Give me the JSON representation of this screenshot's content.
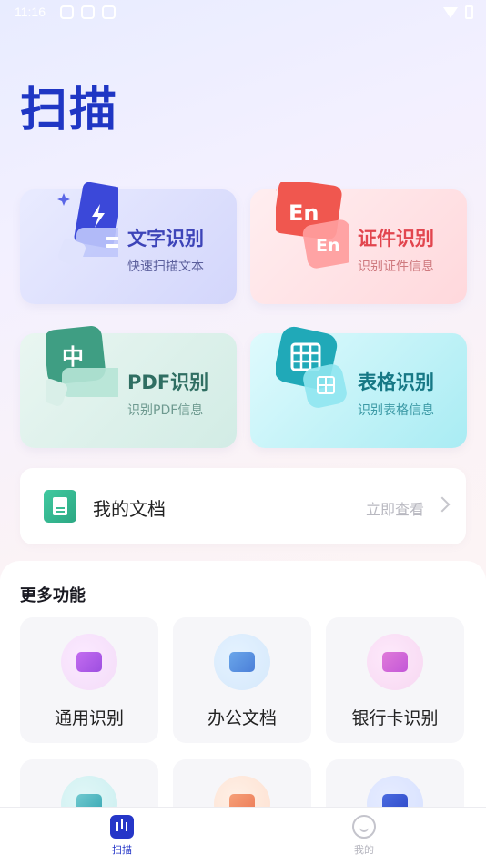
{
  "status_bar": {
    "time": "11:16"
  },
  "page": {
    "title": "扫描"
  },
  "feature_cards": [
    {
      "title": "文字识别",
      "subtitle": "快速扫描文本"
    },
    {
      "title": "证件识别",
      "subtitle": "识别证件信息",
      "art_label_1": "En",
      "art_label_2": "En"
    },
    {
      "title": "PDF识别",
      "subtitle": "识别PDF信息",
      "art_label": "中"
    },
    {
      "title": "表格识别",
      "subtitle": "识别表格信息"
    }
  ],
  "documents": {
    "title": "我的文档",
    "link": "立即查看"
  },
  "more": {
    "title": "更多功能",
    "tiles": [
      {
        "label": "通用识别",
        "icon": "camera-icon"
      },
      {
        "label": "办公文档",
        "icon": "document-icon"
      },
      {
        "label": "银行卡识别",
        "icon": "bank-card-icon"
      },
      {
        "label": "",
        "icon": "id-photo-icon"
      },
      {
        "label": "",
        "icon": "edit-icon"
      },
      {
        "label": "",
        "icon": "scan-doc-icon"
      }
    ]
  },
  "bottom_nav": {
    "items": [
      {
        "label": "扫描",
        "active": true
      },
      {
        "label": "我的",
        "active": false
      }
    ]
  },
  "colors": {
    "brand": "#2536c8",
    "title": "#1f36c4",
    "text_card_title": "#3d44b8",
    "id_card_title": "#e2454e",
    "pdf_card_title": "#2f6e62",
    "table_card_title": "#167885"
  }
}
